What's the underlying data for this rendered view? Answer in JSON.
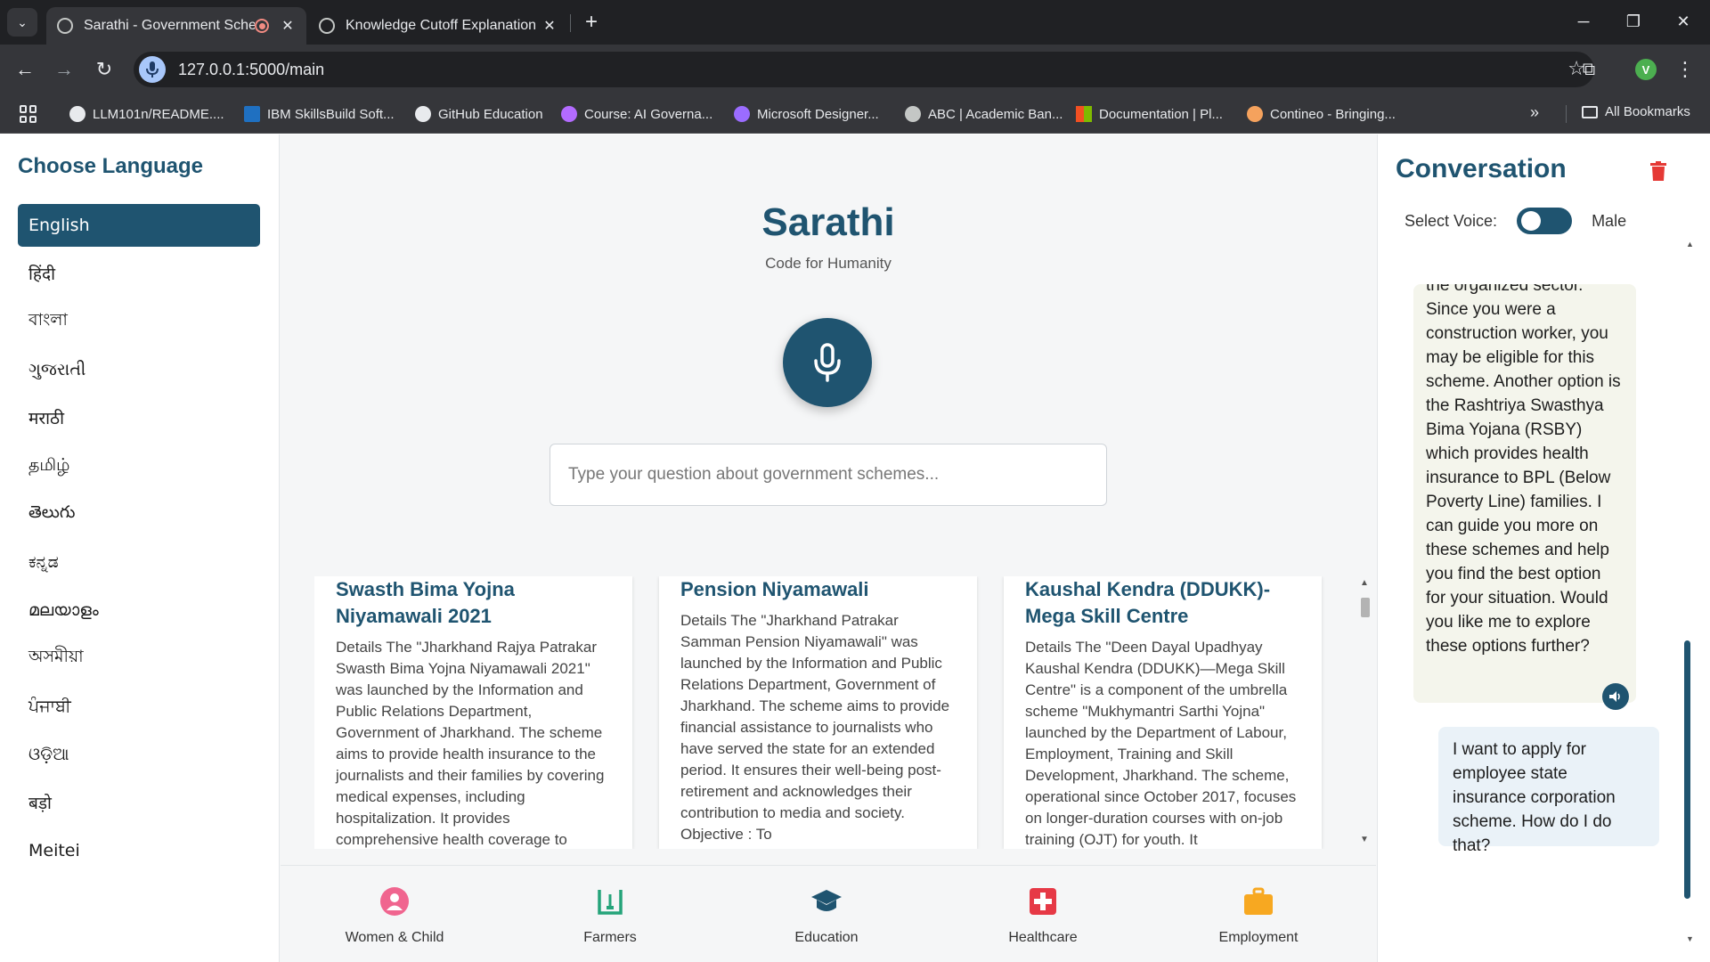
{
  "browser": {
    "tabs": [
      {
        "title": "Sarathi - Government Scher",
        "close": "✕"
      },
      {
        "title": "Knowledge Cutoff Explanation",
        "close": "✕"
      }
    ],
    "new_tab": "+",
    "window_controls": {
      "minimize": "─",
      "restore": "❐",
      "close": "✕"
    },
    "url": "127.0.0.1:5000/main",
    "profile_initial": "V",
    "bookmarks": [
      {
        "label": "LLM101n/README....",
        "icon": "github-icon",
        "color": "#e8eaed"
      },
      {
        "label": "IBM SkillsBuild Soft...",
        "icon": "ibm-icon",
        "color": "#1f70c1"
      },
      {
        "label": "GitHub Education",
        "icon": "github-icon",
        "color": "#e8eaed"
      },
      {
        "label": "Course: AI Governa...",
        "icon": "course-icon",
        "color": "#b36bff"
      },
      {
        "label": "Microsoft Designer...",
        "icon": "designer-icon",
        "color": "#9b6cff"
      },
      {
        "label": "ABC | Academic Ban...",
        "icon": "globe-icon",
        "color": "#c4c7c5"
      },
      {
        "label": "Documentation | Pl...",
        "icon": "microsoft-icon",
        "color": "#f25022"
      },
      {
        "label": "Contineo - Bringing...",
        "icon": "contineo-icon",
        "color": "#f5a25d"
      }
    ],
    "all_bookmarks": "All Bookmarks"
  },
  "sidebar": {
    "title": "Choose Language",
    "languages": [
      "English",
      "हिंदी",
      "বাংলা",
      "ગુજરાતી",
      "मराठी",
      "தமிழ்",
      "తెలుగు",
      "ಕನ್ನಡ",
      "മലയാളം",
      "অসমীয়া",
      "ਪੰਜਾਬੀ",
      "ଓଡ଼ିଆ",
      "बड़ो",
      "Meitei"
    ],
    "selected": "English"
  },
  "main": {
    "brand": "Sarathi",
    "tagline": "Code for Humanity",
    "search_placeholder": "Type your question about government schemes...",
    "cards": [
      {
        "title": "Swasth Bima Yojna Niyamawali 2021",
        "details": "Details The \"Jharkhand Rajya Patrakar Swasth Bima Yojna Niyamawali 2021\" was launched by the Information and Public Relations Department, Government of Jharkhand. The scheme aims to provide health insurance to the journalists and their families by covering medical expenses, including hospitalization. It provides comprehensive health coverage to"
      },
      {
        "title": "Pension Niyamawali",
        "details": "Details The \"Jharkhand Patrakar Samman Pension Niyamawali\" was launched by the Information and Public Relations Department, Government of Jharkhand. The scheme aims to provide financial assistance to journalists who have served the state for an extended period. It ensures their well-being post-retirement and acknowledges their contribution to media and society.  Objective : To"
      },
      {
        "title": "Kaushal Kendra (DDUKK)- Mega Skill Centre",
        "details": "Details The \"Deen Dayal Upadhyay Kaushal Kendra (DDUKK)—Mega Skill Centre\" is a component of the umbrella scheme \"Mukhymantri Sarthi Yojna\" launched by the Department of Labour, Employment, Training and Skill Development, Jharkhand. The scheme, operational since October 2017, focuses on longer-duration courses with on-job training (OJT) for youth. It"
      }
    ],
    "categories": [
      {
        "label": "Women & Child",
        "icon": "person-icon",
        "color": "#f0658f"
      },
      {
        "label": "Farmers",
        "icon": "plant-icon",
        "color": "#25a47a"
      },
      {
        "label": "Education",
        "icon": "graduation-cap-icon",
        "color": "#1f5470"
      },
      {
        "label": "Healthcare",
        "icon": "medical-cross-icon",
        "color": "#e63946"
      },
      {
        "label": "Employment",
        "icon": "briefcase-icon",
        "color": "#f7a821"
      }
    ]
  },
  "conversation": {
    "title": "Conversation",
    "voice_label": "Select Voice:",
    "voice_value": "Male",
    "bot_message": "the organized sector. Since you were a construction worker, you may be eligible for this scheme. Another option is the Rashtriya Swasthya Bima Yojana (RSBY) which provides health insurance to BPL (Below Poverty Line) families. I can guide you more on these schemes and help you find the best option for your situation. Would you like me to explore these options further?",
    "user_message": "I want to apply for employee state insurance corporation scheme. How do I do that?"
  },
  "colors": {
    "primary": "#1f5470",
    "delete": "#e53935"
  }
}
